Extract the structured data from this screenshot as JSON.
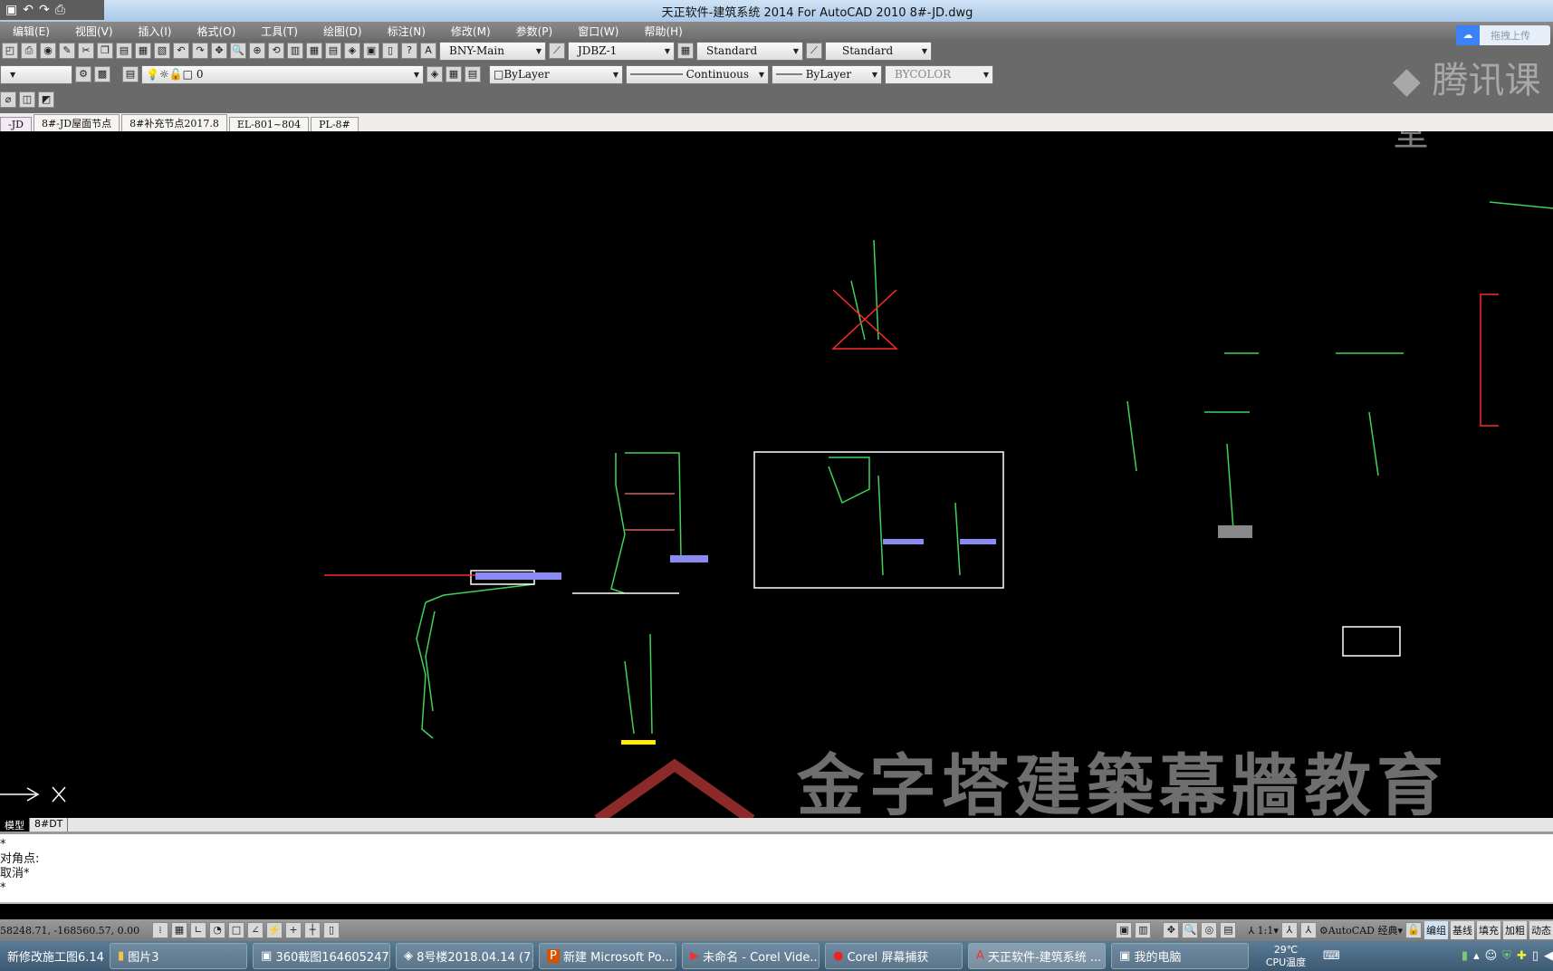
{
  "window": {
    "title": "天正软件-建筑系统 2014  For AutoCAD 2010      8#-JD.dwg"
  },
  "menu": [
    "编辑(E)",
    "视图(V)",
    "插入(I)",
    "格式(O)",
    "工具(T)",
    "绘图(D)",
    "标注(N)",
    "修改(M)",
    "参数(P)",
    "窗口(W)",
    "帮助(H)"
  ],
  "toolbar": {
    "text_style": "BNY-Main",
    "dim_style": "JDBZ-1",
    "table_style": "Standard",
    "mleader_style": "Standard",
    "layer": "0",
    "color": "ByLayer",
    "linetype": "Continuous",
    "lineweight": "ByLayer",
    "plotstyle": "BYCOLOR",
    "upload_label": "拖拽上传"
  },
  "doc_tabs": [
    "-JD",
    "8#-JD屋面节点",
    "8#补充节点2017.8",
    "EL-801~804",
    "PL-8#"
  ],
  "layout_tabs": [
    "模型",
    "8#DT"
  ],
  "command_lines": [
    "*",
    "对角点:",
    "取消*",
    "*"
  ],
  "status": {
    "coords": "58248.71, -168560.57, 0.00",
    "scale": "1:1",
    "workspace": "AutoCAD 经典",
    "buttons": [
      "编组",
      "基线",
      "填充",
      "加粗",
      "动态"
    ]
  },
  "taskbar": {
    "items": [
      "新修改施工图6.14",
      "图片3",
      "360截图164605247...",
      "8号楼2018.04.14 (7...",
      "新建 Microsoft Po...",
      "未命名 - Corel Vide...",
      "Corel 屏幕捕获",
      "天正软件-建筑系统 ...",
      "我的电脑"
    ],
    "temp": "29℃",
    "temp_label": "CPU温度"
  },
  "watermarks": {
    "tencent": "腾讯课堂",
    "school": "金字塔建築幕牆教育"
  },
  "colors": {
    "drawing_green": "#3fd35a",
    "drawing_red": "#ff2a2a",
    "drawing_blue": "#8a8af0",
    "drawing_yellow": "#ffee00"
  }
}
